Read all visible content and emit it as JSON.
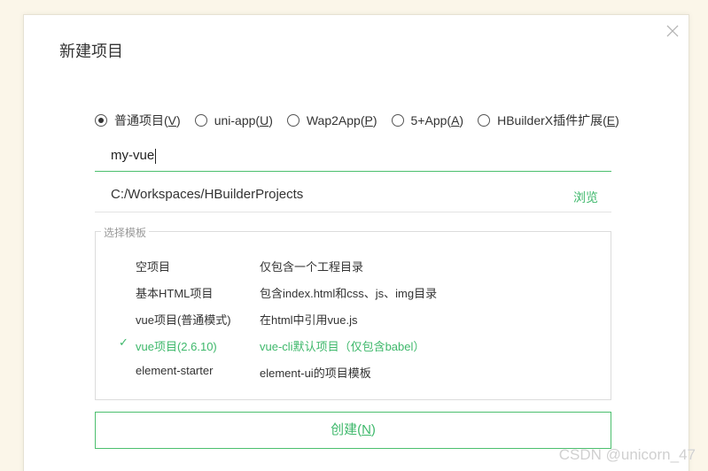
{
  "dialog": {
    "title": "新建项目",
    "close_icon": "close-icon"
  },
  "project_types": [
    {
      "label": "普通项目",
      "hotkey": "V",
      "checked": true
    },
    {
      "label": "uni-app",
      "hotkey": "U",
      "checked": false
    },
    {
      "label": "Wap2App",
      "hotkey": "P",
      "checked": false
    },
    {
      "label": "5+App",
      "hotkey": "A",
      "checked": false
    },
    {
      "label": "HBuilderX插件扩展",
      "hotkey": "E",
      "checked": false
    }
  ],
  "name_field": {
    "value": "my-vue"
  },
  "path_field": {
    "value": "C:/Workspaces/HBuilderProjects",
    "browse_label": "浏览"
  },
  "templates": {
    "legend": "选择模板",
    "items": [
      {
        "name": "空项目",
        "desc": "仅包含一个工程目录",
        "selected": false
      },
      {
        "name": "基本HTML项目",
        "desc": "包含index.html和css、js、img目录",
        "selected": false
      },
      {
        "name": "vue项目(普通模式)",
        "desc": "在html中引用vue.js",
        "selected": false
      },
      {
        "name": "vue项目(2.6.10)",
        "desc": "vue-cli默认项目（仅包含babel）",
        "selected": true
      },
      {
        "name": "element-starter",
        "desc": "element-ui的项目模板",
        "selected": false
      }
    ]
  },
  "create_button": {
    "label": "创建",
    "hotkey": "N"
  },
  "watermark": "CSDN @unicorn_47",
  "colors": {
    "accent": "#3eb86b",
    "accent_border": "#4cbf6e",
    "background": "#fbf6e9"
  }
}
